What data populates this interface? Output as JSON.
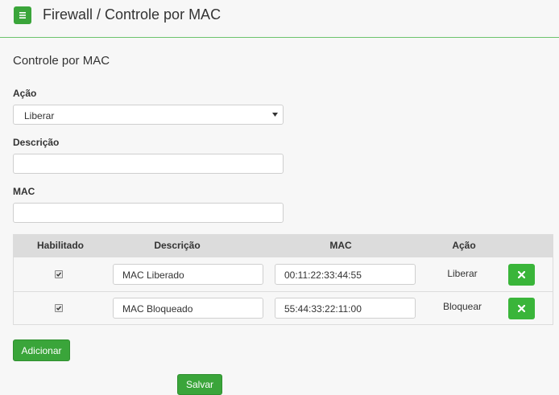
{
  "header": {
    "title": "Firewall / Controle por MAC",
    "menu_icon": "hamburger-icon"
  },
  "form": {
    "section_title": "Controle por MAC",
    "action_label": "Ação",
    "action_value": "Liberar",
    "description_label": "Descrição",
    "description_value": "",
    "mac_label": "MAC",
    "mac_value": ""
  },
  "table": {
    "headers": [
      "Habilitado",
      "Descrição",
      "MAC",
      "Ação"
    ],
    "rows": [
      {
        "enabled": true,
        "description": "MAC Liberado",
        "mac": "00:11:22:33:44:55",
        "action": "Liberar"
      },
      {
        "enabled": true,
        "description": "MAC Bloqueado",
        "mac": "55:44:33:22:11:00",
        "action": "Bloquear"
      }
    ]
  },
  "buttons": {
    "add_label": "Adicionar",
    "save_label": "Salvar"
  },
  "colors": {
    "accent": "#3aa53a",
    "divider": "#6cc36c",
    "table_header": "#dcdcdc"
  }
}
